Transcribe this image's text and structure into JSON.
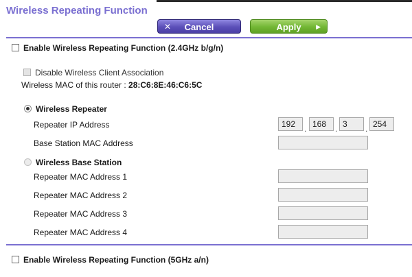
{
  "page": {
    "title": "Wireless Repeating Function"
  },
  "toolbar": {
    "cancel_icon": "x-icon",
    "cancel_glyph": "✕",
    "cancel_label": "Cancel",
    "apply_label": "Apply",
    "apply_icon": "arrow-right-icon",
    "apply_glyph": "▶"
  },
  "colors": {
    "accent": "#7a6fd1",
    "cancel_button": "#5b4fb8",
    "apply_button": "#72b634"
  },
  "band_24": {
    "enable_label": "Enable Wireless Repeating Function (2.4GHz b/g/n)",
    "enabled": false,
    "disable_client_association_label": "Disable Wireless Client Association",
    "mac_label": "Wireless MAC of this router :",
    "mac_value": "28:C6:8E:46:C6:5C",
    "mode_repeater_label": "Wireless Repeater",
    "mode_repeater_selected": true,
    "repeater_ip_label": "Repeater IP Address",
    "repeater_ip": [
      "192",
      "168",
      "3",
      "254"
    ],
    "base_station_mac_label": "Base Station MAC Address",
    "base_station_mac_value": "",
    "mode_base_station_label": "Wireless Base Station",
    "mode_base_station_selected": false,
    "repeater_macs": [
      {
        "label": "Repeater MAC Address 1",
        "value": ""
      },
      {
        "label": "Repeater MAC Address 2",
        "value": ""
      },
      {
        "label": "Repeater MAC Address 3",
        "value": ""
      },
      {
        "label": "Repeater MAC Address 4",
        "value": ""
      }
    ]
  },
  "band_5": {
    "enable_label": "Enable Wireless Repeating Function (5GHz a/n)",
    "enabled": false
  }
}
